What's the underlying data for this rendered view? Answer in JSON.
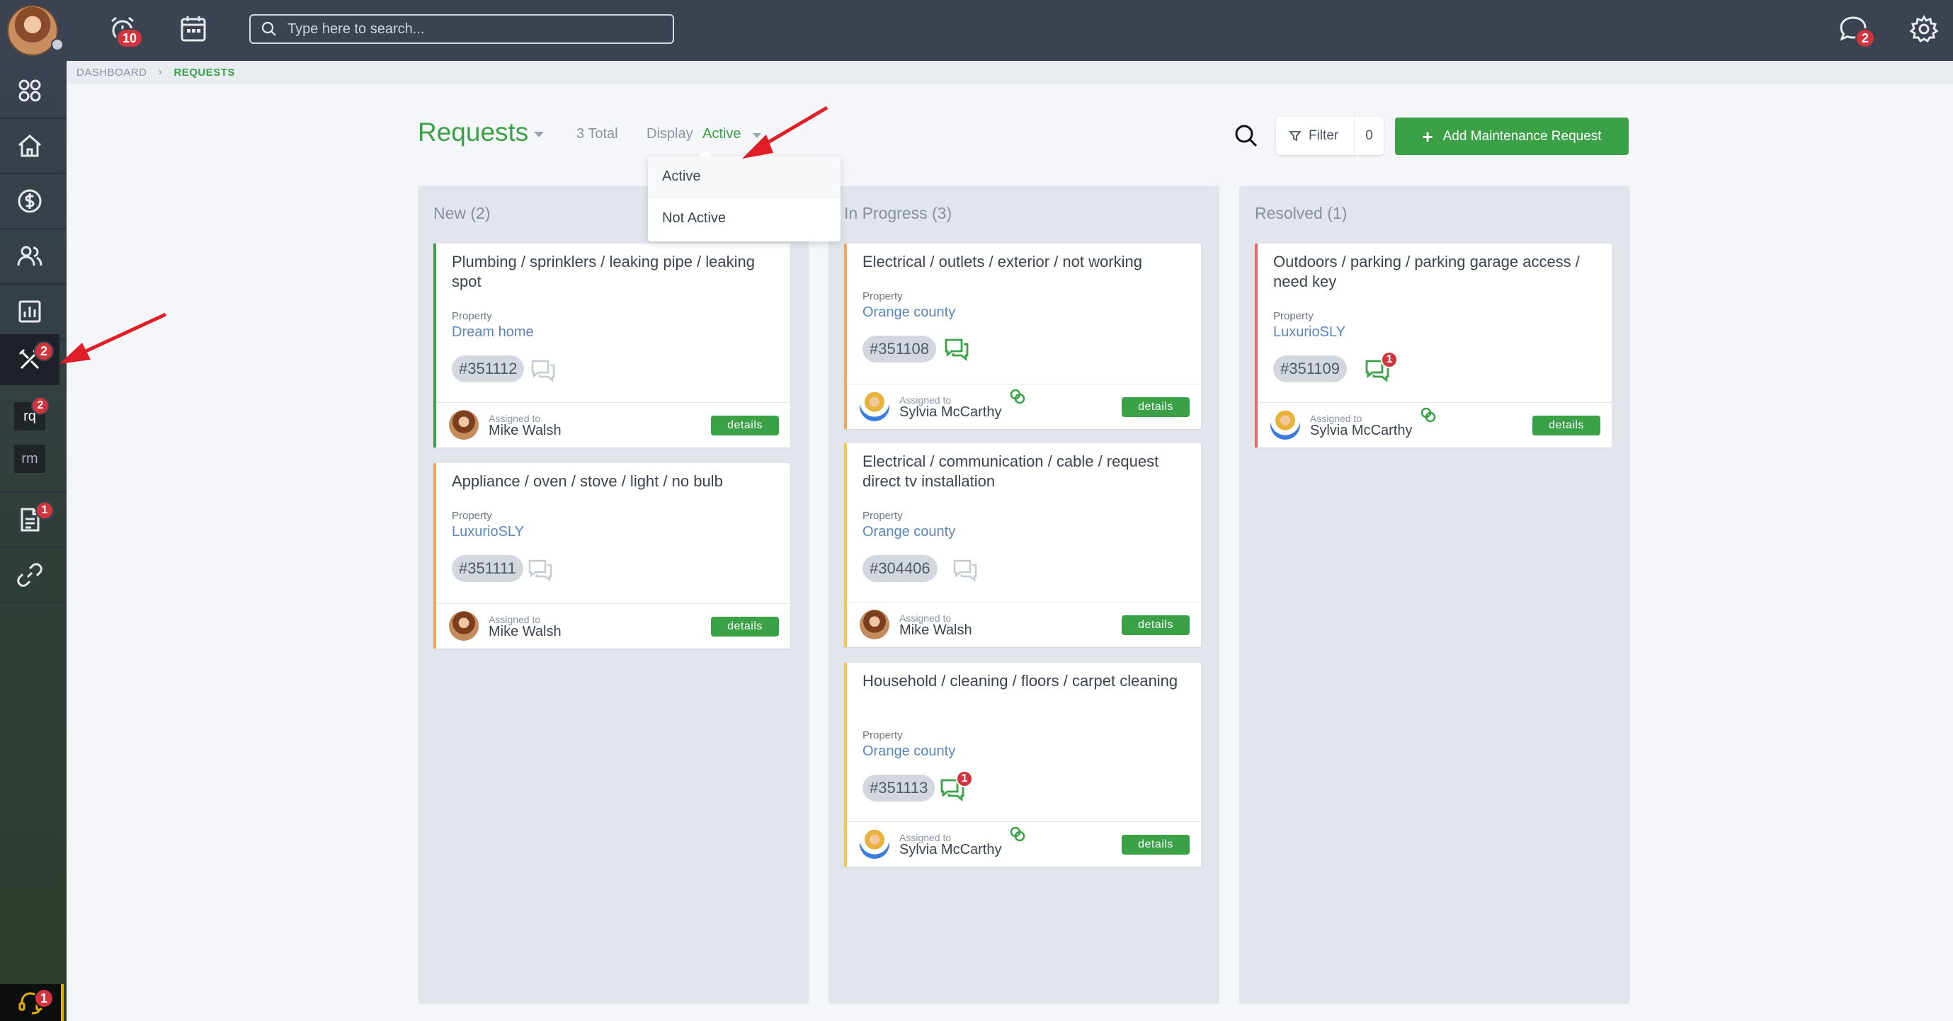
{
  "topbar": {
    "notifications_count": "10",
    "messages_count": "2",
    "search_placeholder": "Type here to search..."
  },
  "sidebar": {
    "maintenance_badge": "2",
    "sub_items": [
      {
        "label": "rq",
        "badge": "2"
      },
      {
        "label": "rm"
      }
    ],
    "documents_badge": "1",
    "support_badge": "1"
  },
  "breadcrumb": {
    "items": [
      "DASHBOARD",
      "REQUESTS"
    ]
  },
  "header": {
    "title": "Requests",
    "total": "3 Total",
    "display_label": "Display",
    "display_value": "Active",
    "filter_label": "Filter",
    "filter_count": "0",
    "add_label": "Add Maintenance Request"
  },
  "dropdown": {
    "options": [
      "Active",
      "Not Active"
    ]
  },
  "columns": [
    {
      "title": "New (2)",
      "cards": [
        {
          "title": "Plumbing / sprinklers / leaking pipe / leaking spot",
          "property_label": "Property",
          "property": "Dream home",
          "id": "#351112",
          "assigned_label": "Assigned to",
          "assignee": "Mike Walsh",
          "details": "details"
        },
        {
          "title": "Appliance / oven / stove / light / no bulb",
          "property_label": "Property",
          "property": "LuxurioSLY",
          "id": "#351111",
          "assigned_label": "Assigned to",
          "assignee": "Mike Walsh",
          "details": "details"
        }
      ]
    },
    {
      "title": "In Progress (3)",
      "cards": [
        {
          "title": "Electrical / outlets / exterior / not working",
          "property_label": "Property",
          "property": "Orange county",
          "id": "#351108",
          "assigned_label": "Assigned to",
          "assignee": "Sylvia McCarthy",
          "details": "details"
        },
        {
          "title": "Electrical / communication / cable / request direct tv installation",
          "property_label": "Property",
          "property": "Orange county",
          "id": "#304406",
          "assigned_label": "Assigned to",
          "assignee": "Mike Walsh",
          "details": "details"
        },
        {
          "title": "Household / cleaning / floors / carpet cleaning",
          "property_label": "Property",
          "property": "Orange county",
          "id": "#351113",
          "chat_badge": "1",
          "assigned_label": "Assigned to",
          "assignee": "Sylvia McCarthy",
          "details": "details"
        }
      ]
    },
    {
      "title": "Resolved (1)",
      "cards": [
        {
          "title": "Outdoors / parking / parking garage access / need key",
          "property_label": "Property",
          "property": "LuxurioSLY",
          "id": "#351109",
          "chat_badge": "1",
          "assigned_label": "Assigned to",
          "assignee": "Sylvia McCarthy",
          "details": "details"
        }
      ]
    }
  ],
  "colors": {
    "accent_green": "#3aa147",
    "new_border": "#3aa147",
    "second_border": "#f2a65a",
    "in_progress_border": "#f2c94c",
    "resolved_border": "#e06c6c",
    "badge_red": "#d0343c",
    "property_link": "#5a86b8"
  }
}
